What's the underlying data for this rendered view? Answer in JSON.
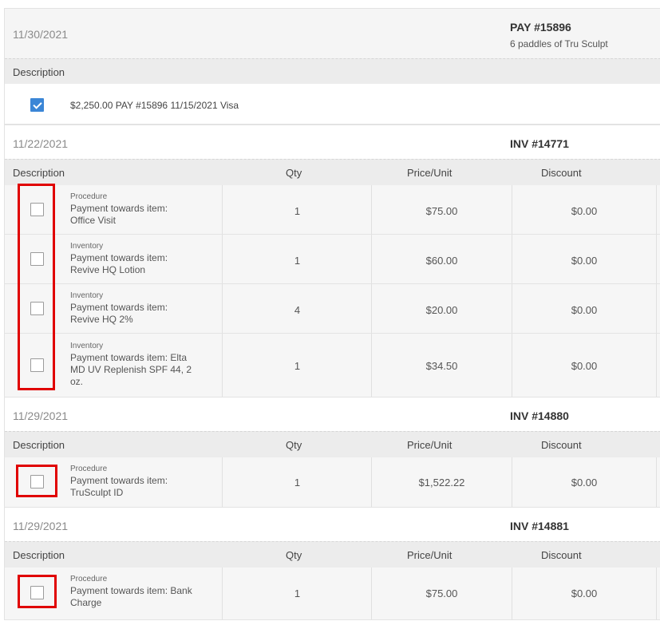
{
  "payment": {
    "date": "11/30/2021",
    "ref": "PAY #15896",
    "subtitle": "6 paddles of Tru Sculpt",
    "column": "Description",
    "line": "$2,250.00 PAY #15896 11/15/2021 Visa",
    "checked": true
  },
  "columns": {
    "desc": "Description",
    "qty": "Qty",
    "price": "Price/Unit",
    "discount": "Discount"
  },
  "invoices": [
    {
      "date": "11/22/2021",
      "ref": "INV #14771",
      "items": [
        {
          "category": "Procedure",
          "line1": "Payment towards item:",
          "line2": "Office Visit",
          "line3": "",
          "qty": "1",
          "price": "$75.00",
          "discount": "$0.00"
        },
        {
          "category": "Inventory",
          "line1": "Payment towards item:",
          "line2": "Revive HQ Lotion",
          "line3": "",
          "qty": "1",
          "price": "$60.00",
          "discount": "$0.00"
        },
        {
          "category": "Inventory",
          "line1": "Payment towards item:",
          "line2": "Revive HQ 2%",
          "line3": "",
          "qty": "4",
          "price": "$20.00",
          "discount": "$0.00"
        },
        {
          "category": "Inventory",
          "line1": "Payment towards item: Elta",
          "line2": "MD UV Replenish SPF 44, 2",
          "line3": "oz.",
          "qty": "1",
          "price": "$34.50",
          "discount": "$0.00"
        }
      ]
    },
    {
      "date": "11/29/2021",
      "ref": "INV #14880",
      "items": [
        {
          "category": "Procedure",
          "line1": "Payment towards item:",
          "line2": "TruSculpt ID",
          "line3": "",
          "qty": "1",
          "price": "$1,522.22",
          "discount": "$0.00"
        }
      ]
    },
    {
      "date": "11/29/2021",
      "ref": "INV #14881",
      "items": [
        {
          "category": "Procedure",
          "line1": "Payment towards item: Bank",
          "line2": "Charge",
          "line3": "",
          "qty": "1",
          "price": "$75.00",
          "discount": "$0.00"
        }
      ]
    }
  ],
  "colors": {
    "highlight": "#e00000",
    "checkbox_checked": "#3b86d6"
  }
}
